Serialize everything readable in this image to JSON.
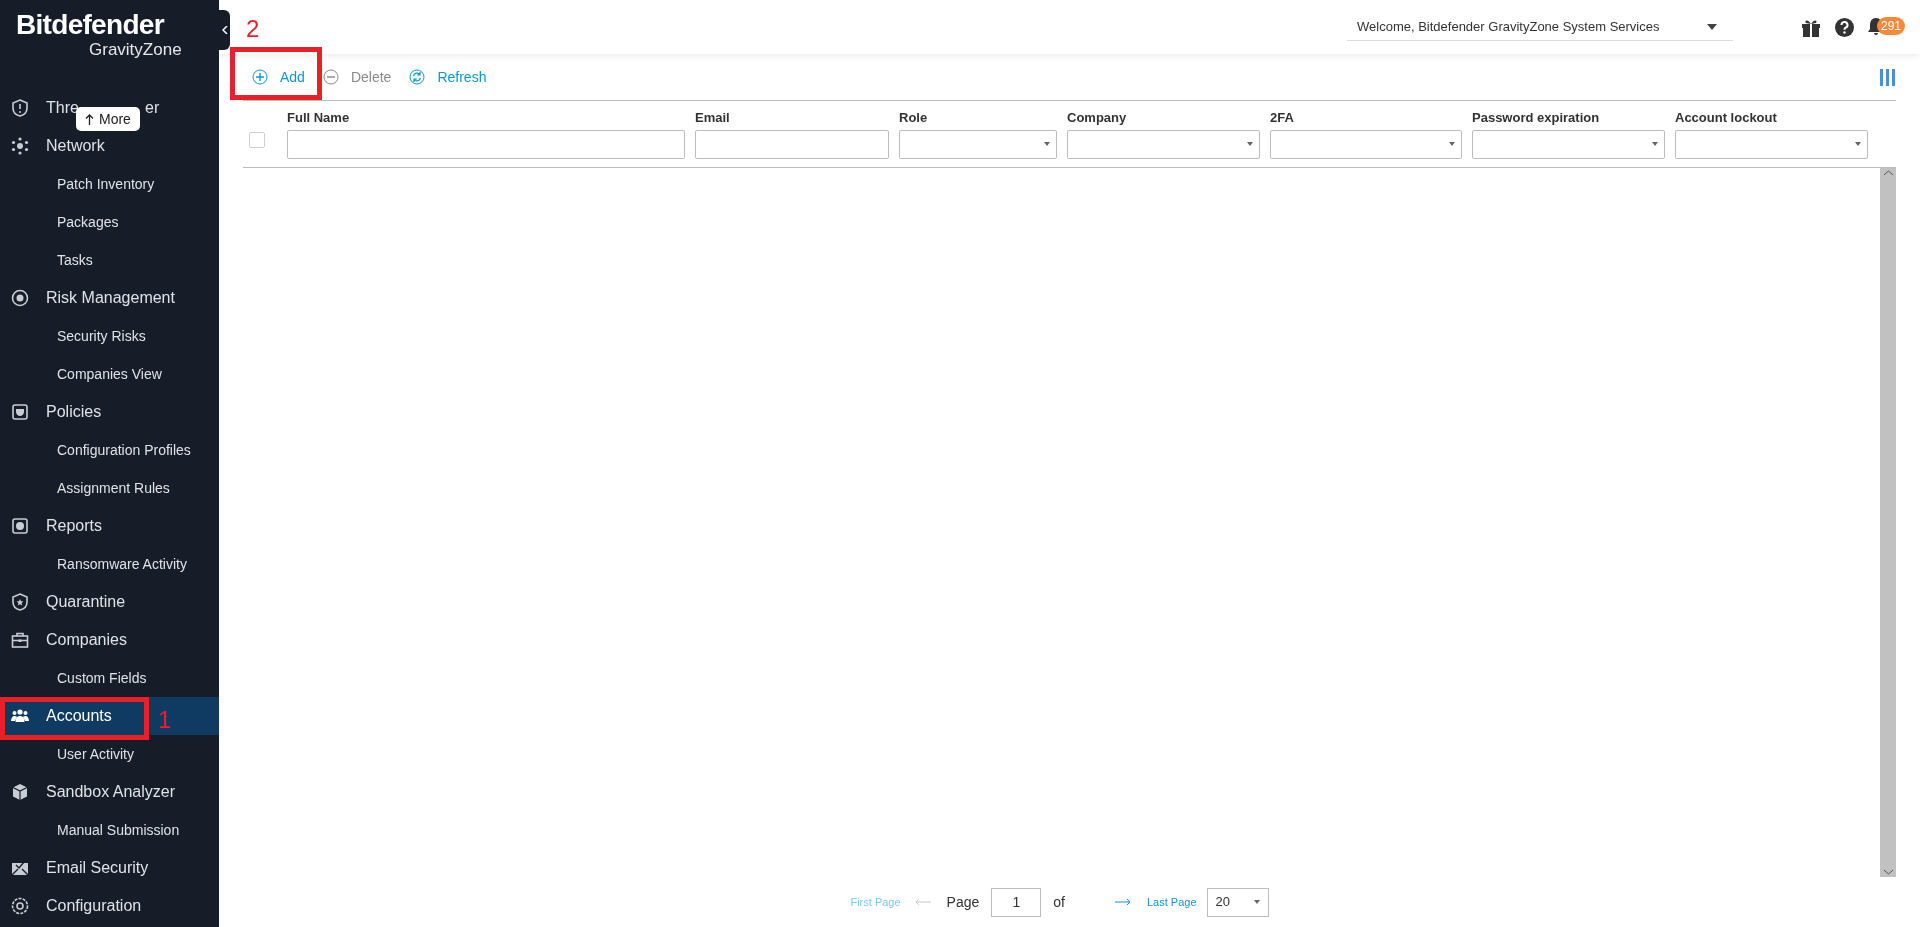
{
  "brand": {
    "name": "Bitdefender",
    "product": "GravityZone"
  },
  "sidebar": {
    "more_button": "More",
    "items": [
      {
        "kind": "section",
        "label": "Thre",
        "label_tail": "er",
        "selected": false
      },
      {
        "kind": "section",
        "label": "Network",
        "selected": false
      },
      {
        "kind": "sub",
        "label": "Patch Inventory",
        "selected": false
      },
      {
        "kind": "sub",
        "label": "Packages",
        "selected": false
      },
      {
        "kind": "sub",
        "label": "Tasks",
        "selected": false
      },
      {
        "kind": "section",
        "label": "Risk Management",
        "selected": false
      },
      {
        "kind": "sub",
        "label": "Security Risks",
        "selected": false
      },
      {
        "kind": "sub",
        "label": "Companies View",
        "selected": false
      },
      {
        "kind": "section",
        "label": "Policies",
        "selected": false
      },
      {
        "kind": "sub",
        "label": "Configuration Profiles",
        "selected": false
      },
      {
        "kind": "sub",
        "label": "Assignment Rules",
        "selected": false
      },
      {
        "kind": "section",
        "label": "Reports",
        "selected": false
      },
      {
        "kind": "sub",
        "label": "Ransomware Activity",
        "selected": false
      },
      {
        "kind": "section",
        "label": "Quarantine",
        "selected": false
      },
      {
        "kind": "section",
        "label": "Companies",
        "selected": false
      },
      {
        "kind": "sub",
        "label": "Custom Fields",
        "selected": false
      },
      {
        "kind": "section",
        "label": "Accounts",
        "selected": true
      },
      {
        "kind": "sub",
        "label": "User Activity",
        "selected": false
      },
      {
        "kind": "section",
        "label": "Sandbox Analyzer",
        "selected": false
      },
      {
        "kind": "sub",
        "label": "Manual Submission",
        "selected": false
      },
      {
        "kind": "section",
        "label": "Email Security",
        "selected": false
      },
      {
        "kind": "section",
        "label": "Configuration",
        "selected": false
      }
    ]
  },
  "header": {
    "welcome": "Welcome, Bitdefender GravityZone System Services",
    "notifications": "291"
  },
  "toolbar": [
    {
      "kind": "add",
      "label": "Add",
      "disabled": false
    },
    {
      "kind": "delete",
      "label": "Delete",
      "disabled": true
    },
    {
      "kind": "refresh",
      "label": "Refresh",
      "disabled": false
    }
  ],
  "table": {
    "select_all": {
      "checked": false
    },
    "columns": [
      {
        "label": "Full Name",
        "kind": "text"
      },
      {
        "label": "Email",
        "kind": "text"
      },
      {
        "label": "Role",
        "kind": "select"
      },
      {
        "label": "Company",
        "kind": "select"
      },
      {
        "label": "2FA",
        "kind": "select"
      },
      {
        "label": "Password expiration",
        "kind": "select"
      },
      {
        "label": "Account lockout",
        "kind": "select"
      }
    ]
  },
  "pagination": {
    "first": "First Page",
    "page_label": "Page",
    "page": "1",
    "of": "of",
    "last": "Last Page",
    "page_size": "20"
  },
  "annotations": [
    {
      "number": "1"
    },
    {
      "number": "2"
    }
  ]
}
